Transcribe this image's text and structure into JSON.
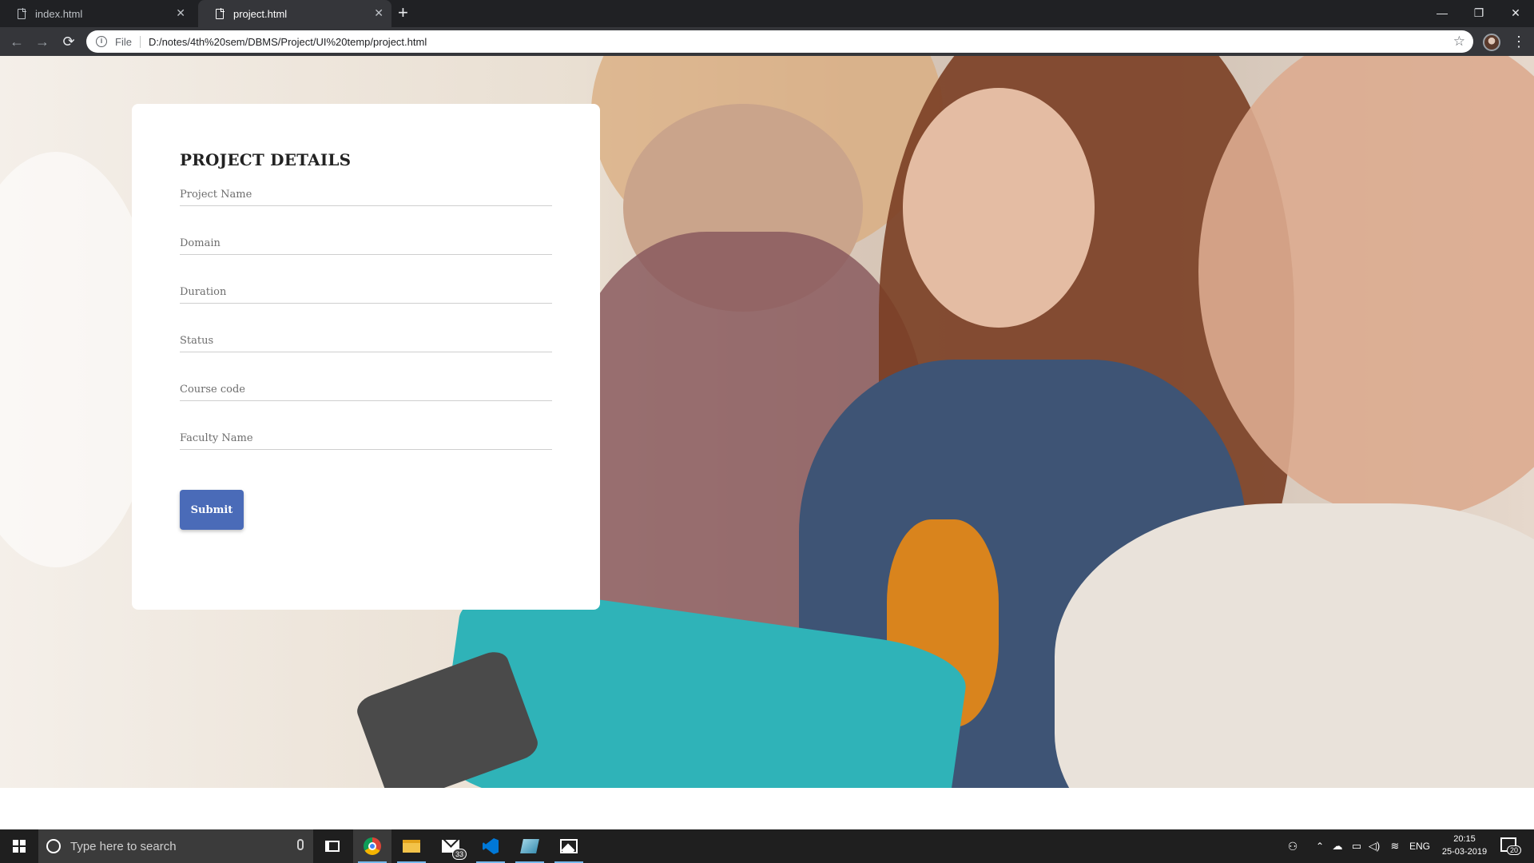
{
  "browser": {
    "tabs": [
      {
        "title": "index.html",
        "active": false
      },
      {
        "title": "project.html",
        "active": true
      }
    ],
    "address": {
      "scheme_label": "File",
      "url": "D:/notes/4th%20sem/DBMS/Project/UI%20temp/project.html"
    },
    "icons": {
      "back": "back-arrow-icon",
      "forward": "forward-arrow-icon",
      "reload": "reload-icon",
      "info": "info-icon",
      "bookmark": "star-icon",
      "menu": "kebab-menu-icon"
    }
  },
  "page": {
    "form": {
      "title": "PROJECT DETAILS",
      "fields": [
        {
          "placeholder": "Project Name",
          "value": ""
        },
        {
          "placeholder": "Domain",
          "value": ""
        },
        {
          "placeholder": "Duration",
          "value": ""
        },
        {
          "placeholder": "Status",
          "value": ""
        },
        {
          "placeholder": "Course code",
          "value": ""
        },
        {
          "placeholder": "Faculty Name",
          "value": ""
        }
      ],
      "submit_label": "Submit"
    },
    "colors": {
      "submit_button": "#4a6bb8",
      "card": "#ffffff"
    }
  },
  "taskbar": {
    "search_placeholder": "Type here to search",
    "apps": [
      {
        "name": "task-view-icon"
      },
      {
        "name": "chrome-icon",
        "active": true
      },
      {
        "name": "file-explorer-icon"
      },
      {
        "name": "mail-icon",
        "badge": "33"
      },
      {
        "name": "vscode-icon"
      },
      {
        "name": "sticky-notes-icon"
      },
      {
        "name": "photos-icon"
      }
    ],
    "tray": {
      "language": "ENG",
      "time": "20:15",
      "date": "25-03-2019",
      "notification_count": "20"
    }
  }
}
